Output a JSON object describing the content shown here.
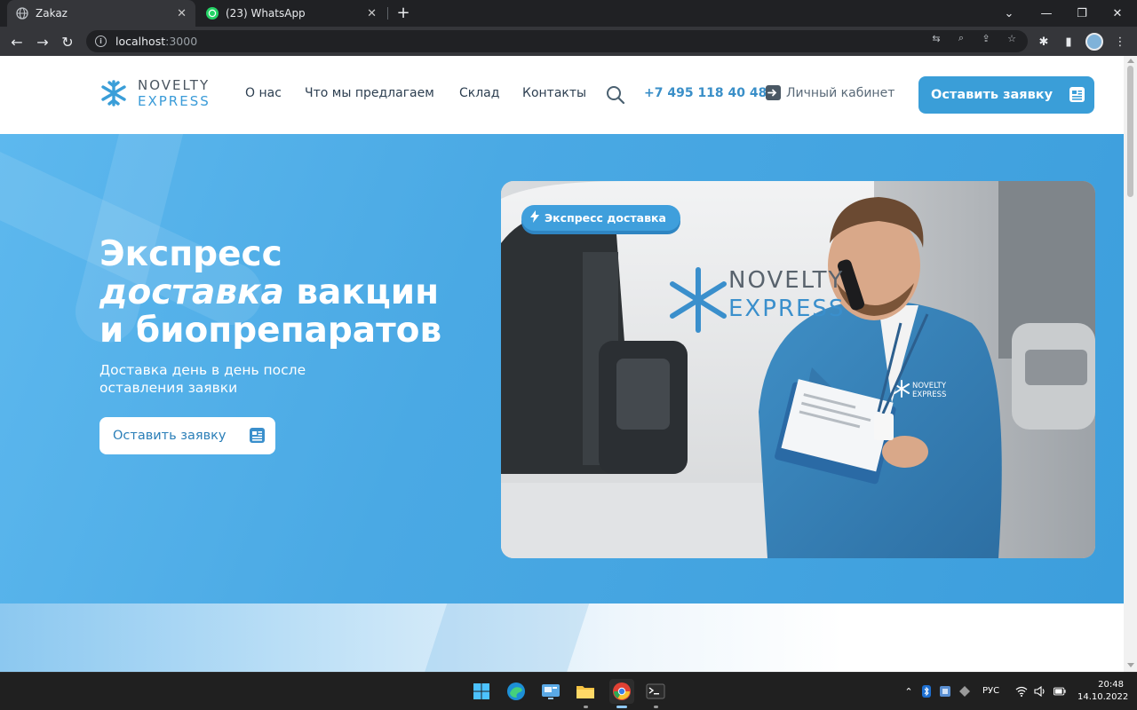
{
  "browser": {
    "tabs": [
      {
        "title": "Zakaz",
        "icon": "globe-icon"
      },
      {
        "title": "(23) WhatsApp",
        "icon": "whatsapp-icon"
      }
    ],
    "address": {
      "host": "localhost",
      "port": ":3000"
    }
  },
  "site": {
    "logo": {
      "line1": "NOVELTY",
      "line2": "EXPRESS"
    },
    "nav": [
      "О нас",
      "Что мы предлагаем",
      "Склад",
      "Контакты"
    ],
    "phone": "+7 495 118 40 48",
    "cabinet": "Личный кабинет",
    "header_cta": "Оставить заявку"
  },
  "hero": {
    "title_line1": "Экспресс",
    "title_em": "доставка",
    "title_rest": " вакцин",
    "title_line3": "и биопрепаратов",
    "subtitle": "Доставка день в день после оставления заявки",
    "cta": "Оставить заявку",
    "badge": "Экспресс доставка",
    "van_text": {
      "line1": "NOVELTY",
      "line2": "EXPRESS"
    },
    "jacket_text": {
      "line1": "NOVELTY",
      "line2": "EXPRESS"
    }
  },
  "taskbar": {
    "apps": [
      "windows-start-icon",
      "edge-icon",
      "control-panel-icon",
      "file-explorer-icon",
      "chrome-icon",
      "terminal-icon"
    ],
    "lang": "РУС",
    "time": "20:48",
    "date": "14.10.2022"
  },
  "colors": {
    "accent": "#3a9ed8",
    "hero_bg": "#4aa9e4",
    "chrome_dark": "#202124"
  }
}
